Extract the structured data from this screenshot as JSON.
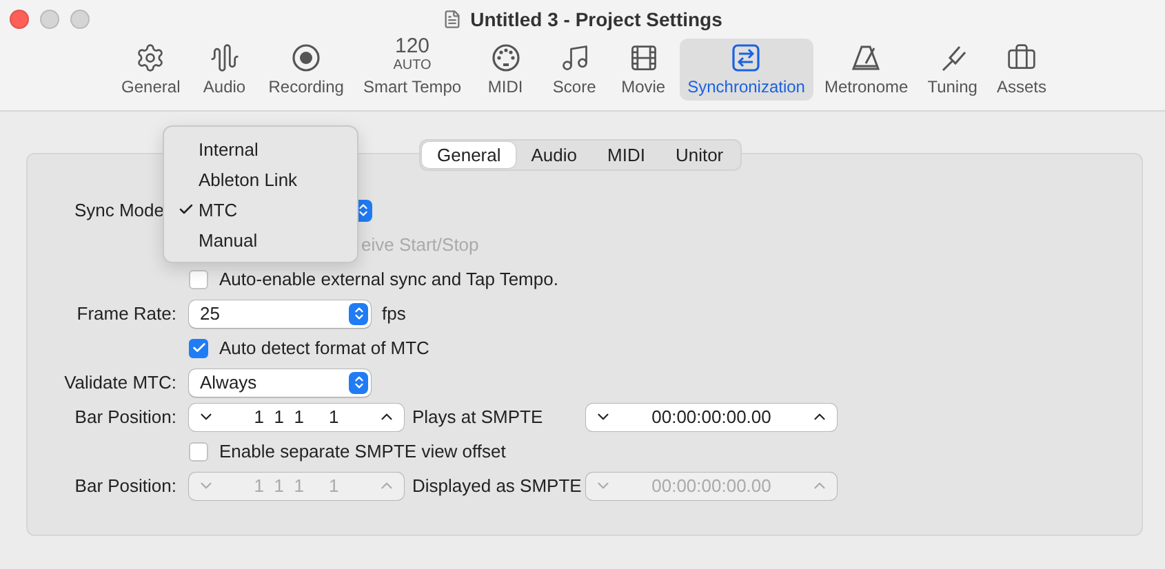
{
  "window": {
    "title": "Untitled 3 - Project Settings"
  },
  "toolbar": [
    {
      "label": "General",
      "kind": "gear",
      "selected": false
    },
    {
      "label": "Audio",
      "kind": "wave",
      "selected": false
    },
    {
      "label": "Recording",
      "kind": "record",
      "selected": false
    },
    {
      "label": "Smart Tempo",
      "kind": "text",
      "value": "120",
      "sub": "AUTO",
      "selected": false
    },
    {
      "label": "MIDI",
      "kind": "midi",
      "selected": false
    },
    {
      "label": "Score",
      "kind": "notes",
      "selected": false
    },
    {
      "label": "Movie",
      "kind": "film",
      "selected": false
    },
    {
      "label": "Synchronization",
      "kind": "sync",
      "selected": true
    },
    {
      "label": "Metronome",
      "kind": "metronome",
      "selected": false
    },
    {
      "label": "Tuning",
      "kind": "fork",
      "selected": false
    },
    {
      "label": "Assets",
      "kind": "case",
      "selected": false
    }
  ],
  "tabs": [
    {
      "label": "General",
      "selected": true
    },
    {
      "label": "Audio",
      "selected": false
    },
    {
      "label": "MIDI",
      "selected": false
    },
    {
      "label": "Unitor",
      "selected": false
    }
  ],
  "rows": [
    {
      "kind": "popup_covered",
      "label": "Sync Mode"
    },
    {
      "kind": "checkbox_covered",
      "label": "eive Start/Stop",
      "disabled": true
    },
    {
      "kind": "checkbox",
      "label": "Auto-enable external sync and Tap Tempo.",
      "checked": false,
      "disabled": false
    },
    {
      "kind": "popup",
      "label": "Frame Rate:",
      "value": "25",
      "unit": "fps"
    },
    {
      "kind": "checkbox",
      "label": "Auto detect format of MTC",
      "checked": true,
      "disabled": false
    },
    {
      "kind": "popup",
      "label": "Validate MTC:",
      "value": "Always"
    },
    {
      "kind": "position",
      "label": "Bar Position:",
      "bar": "1  1  1     1",
      "smpte_label": "Plays at SMPTE",
      "smpte": "00:00:00:00.00",
      "disabled": false
    },
    {
      "kind": "checkbox",
      "label": "Enable separate SMPTE view offset",
      "checked": false,
      "disabled": false
    },
    {
      "kind": "position",
      "label": "Bar Position:",
      "bar": "1  1  1     1",
      "smpte_label": "Displayed as SMPTE",
      "smpte": "00:00:00:00.00",
      "disabled": true
    }
  ],
  "menu": [
    {
      "label": "Internal",
      "checked": false
    },
    {
      "label": "Ableton Link",
      "checked": false
    },
    {
      "label": "MTC",
      "checked": true
    },
    {
      "label": "Manual",
      "checked": false
    }
  ]
}
